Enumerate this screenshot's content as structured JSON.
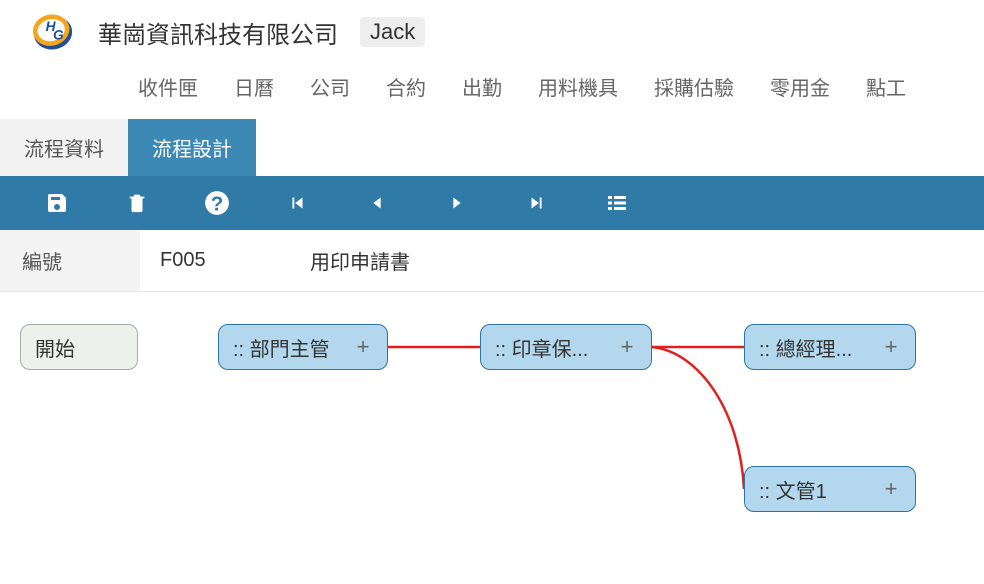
{
  "header": {
    "company": "華崗資訊科技有限公司",
    "user": "Jack"
  },
  "nav": {
    "items": [
      "收件匣",
      "日曆",
      "公司",
      "合約",
      "出勤",
      "用料機具",
      "採購估驗",
      "零用金",
      "點工"
    ]
  },
  "tabs": [
    {
      "label": "流程資料",
      "active": false
    },
    {
      "label": "流程設計",
      "active": true
    }
  ],
  "toolbar": {
    "icons": [
      "save",
      "delete",
      "help",
      "first",
      "prev",
      "next",
      "last",
      "list"
    ]
  },
  "info": {
    "code_label": "編號",
    "code_value": "F005",
    "doc_title": "用印申請書"
  },
  "flow": {
    "start_label": "開始",
    "nodes": [
      {
        "label": ":: 部門主管"
      },
      {
        "label": ":: 印章保..."
      },
      {
        "label": ":: 總經理..."
      },
      {
        "label": ":: 文管1"
      }
    ],
    "add_glyph": "+"
  }
}
